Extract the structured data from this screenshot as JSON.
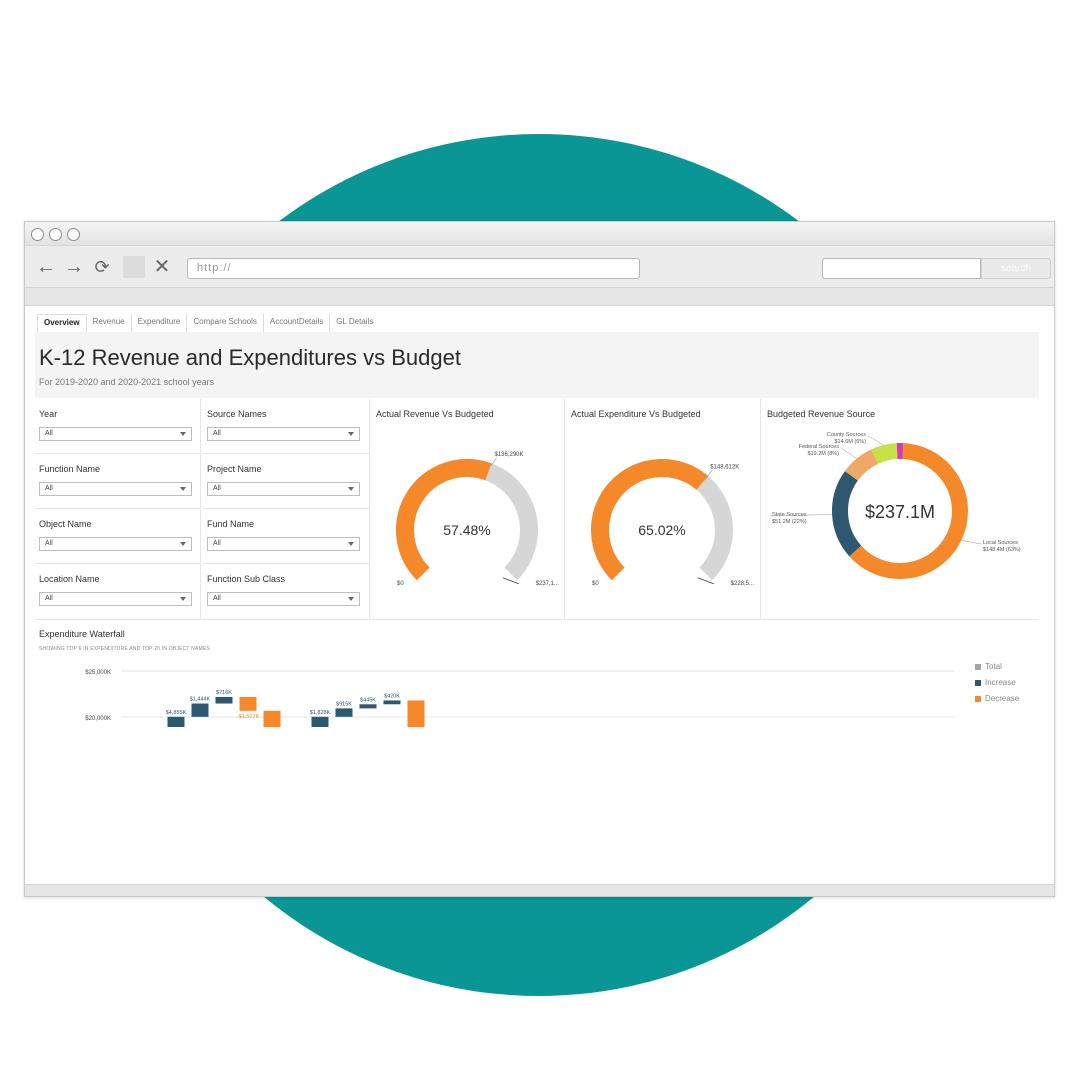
{
  "browser": {
    "url_placeholder": "http://",
    "search_label": "search"
  },
  "tabs": [
    {
      "label": "Overview",
      "active": true
    },
    {
      "label": "Revenue"
    },
    {
      "label": "Expenditure"
    },
    {
      "label": "Compare Schools"
    },
    {
      "label": "AccountDetails"
    },
    {
      "label": "GL Details"
    }
  ],
  "header": {
    "title": "K-12 Revenue and Expenditures vs Budget",
    "subtitle": "For 2019-2020 and 2020-2021 school years"
  },
  "filters": [
    {
      "label": "Year",
      "value": "All"
    },
    {
      "label": "Source Names",
      "value": "All"
    },
    {
      "label": "Function Name",
      "value": "All"
    },
    {
      "label": "Project Name",
      "value": "All"
    },
    {
      "label": "Object Name",
      "value": "All"
    },
    {
      "label": "Fund Name",
      "value": "All"
    },
    {
      "label": "Location Name",
      "value": "All"
    },
    {
      "label": "Function Sub Class",
      "value": "All"
    }
  ],
  "colors": {
    "orange": "#f5892a",
    "gray": "#d6d6d6",
    "navy": "#2d5870",
    "tan": "#f0a868",
    "lime": "#c7e046",
    "magenta": "#d63ca8",
    "teal": "#0a9694"
  },
  "chart_data": [
    {
      "type": "gauge",
      "title": "Actual Revenue Vs Budgeted",
      "percent": 57.48,
      "center_label": "57.48%",
      "actual_label": "$136,290K",
      "min_label": "$0",
      "max_label": "$237,1..."
    },
    {
      "type": "gauge",
      "title": "Actual Expenditure Vs Budgeted",
      "percent": 65.02,
      "center_label": "65.02%",
      "actual_label": "$148,612K",
      "min_label": "$0",
      "max_label": "$228,5..."
    },
    {
      "type": "pie",
      "title": "Budgeted Revenue Source",
      "center_label": "$237.1M",
      "slices": [
        {
          "name": "Local Sources",
          "label": "$148.4M (63%)",
          "value": 148.4,
          "percent": 63
        },
        {
          "name": "State Sources",
          "label": "$51.2M (22%)",
          "value": 51.2,
          "percent": 22
        },
        {
          "name": "Federal Sources",
          "label": "$19.2M (8%)",
          "value": 19.2,
          "percent": 8
        },
        {
          "name": "County Sources",
          "label": "$14.6M (6%)",
          "value": 14.6,
          "percent": 6
        },
        {
          "name": "Other",
          "label": "",
          "value": 3.7,
          "percent": 1
        }
      ]
    },
    {
      "type": "bar",
      "title": "Expenditure Waterfall",
      "subtitle": "SHOWING TOP 6 IN EXPENDITURE AND TOP 20 IN OBJECT NAMES",
      "yticks": [
        "$25,000K",
        "$20,000K"
      ],
      "ylim": [
        20000,
        25000
      ],
      "legend": [
        "Total",
        "Increase",
        "Decrease"
      ],
      "bars": [
        {
          "kind": "increase",
          "label": "$4,855K",
          "start": 18460,
          "end": 20020
        },
        {
          "kind": "increase",
          "label": "$1,444K",
          "start": 20020,
          "end": 21464
        },
        {
          "kind": "increase",
          "label": "$716K",
          "start": 21464,
          "end": 22180
        },
        {
          "kind": "decrease",
          "label": "-$1,507K",
          "start": 22180,
          "end": 20673
        },
        {
          "kind": "decrease",
          "label": "",
          "start": 20673,
          "end": 18460
        },
        {
          "kind": "increase",
          "label": "$1,828K",
          "start": 18800,
          "end": 20020
        },
        {
          "kind": "increase",
          "label": "$915K",
          "start": 20020,
          "end": 20935
        },
        {
          "kind": "increase",
          "label": "$445K",
          "start": 20935,
          "end": 21380
        },
        {
          "kind": "increase",
          "label": "$420K",
          "start": 21380,
          "end": 21800
        },
        {
          "kind": "decrease",
          "label": "",
          "start": 21800,
          "end": 18460
        }
      ]
    }
  ],
  "legend_labels": {
    "total": "Total",
    "increase": "Increase",
    "decrease": "Decrease"
  }
}
